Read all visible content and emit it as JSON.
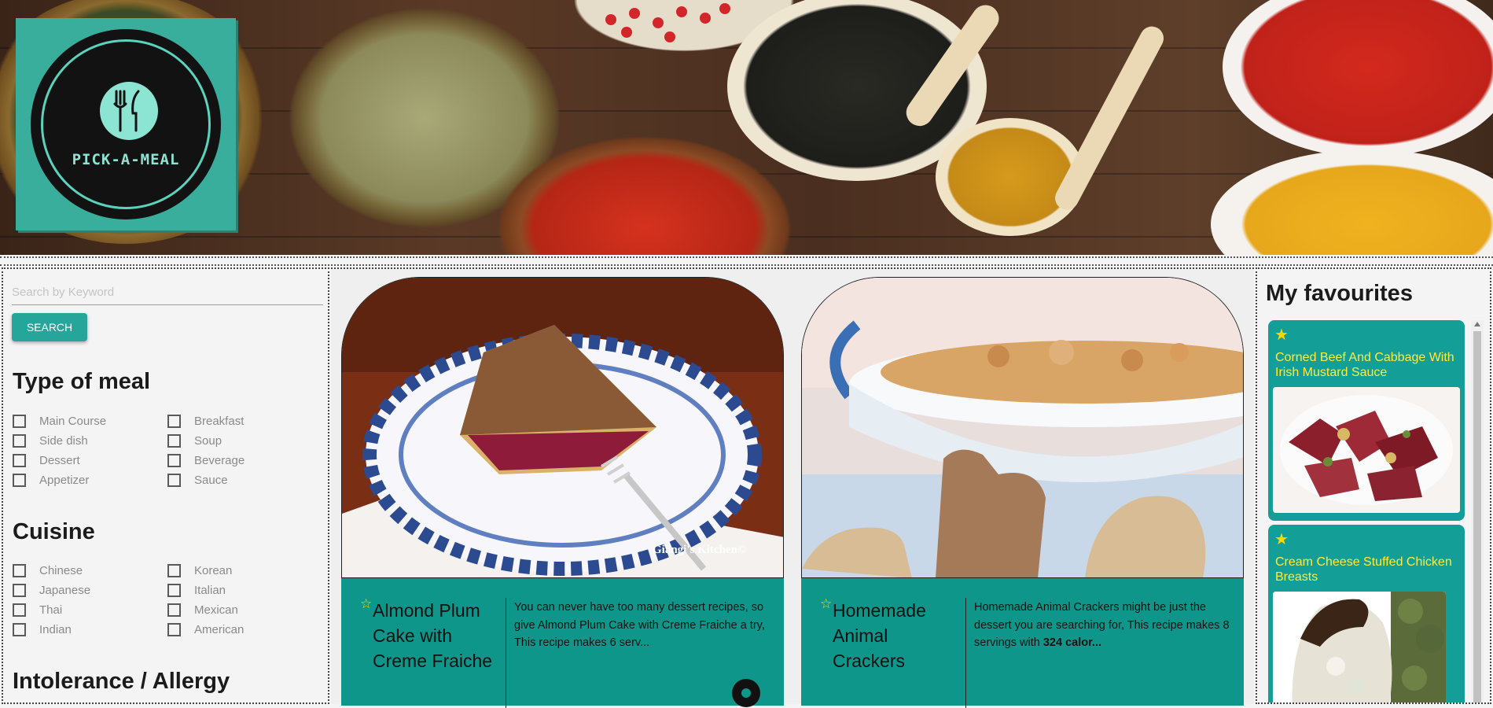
{
  "brand": {
    "logo_text": "PICK-A-MEAL"
  },
  "search": {
    "placeholder": "Search by Keyword",
    "button_label": "SEARCH"
  },
  "filters": {
    "meal_type": {
      "title": "Type of meal",
      "options": [
        "Main Course",
        "Breakfast",
        "Side dish",
        "Soup",
        "Dessert",
        "Beverage",
        "Appetizer",
        "Sauce"
      ]
    },
    "cuisine": {
      "title": "Cuisine",
      "options": [
        "Chinese",
        "Korean",
        "Japanese",
        "Italian",
        "Thai",
        "Mexican",
        "Indian",
        "American"
      ]
    },
    "intolerance": {
      "title": "Intolerance / Allergy"
    }
  },
  "recipes": [
    {
      "title": "Almond Plum Cake with Creme Fraiche",
      "description": "You can never have too many dessert recipes, so give Almond Plum Cake with Creme Fraiche a try, This recipe makes 6 serv...",
      "image_caption": "Giangi's Kitchen©"
    },
    {
      "title": "Homemade Animal Crackers",
      "description_plain": "Homemade Animal Crackers might be just the dessert you are searching for, This recipe makes 8 servings with ",
      "description_bold": "324 calor..."
    }
  ],
  "favourites": {
    "title": "My favourites",
    "items": [
      {
        "name": "Corned Beef And Cabbage With Irish Mustard Sauce"
      },
      {
        "name": "Cream Cheese Stuffed Chicken Breasts"
      }
    ]
  },
  "colors": {
    "teal": "#0f968a",
    "teal_button": "#26a69a",
    "fav_card": "#139f97",
    "star": "#ffd600",
    "fav_text": "#ffeb3b"
  },
  "icons": [
    "fork-knife-icon",
    "star-icon",
    "star-outline-icon"
  ]
}
